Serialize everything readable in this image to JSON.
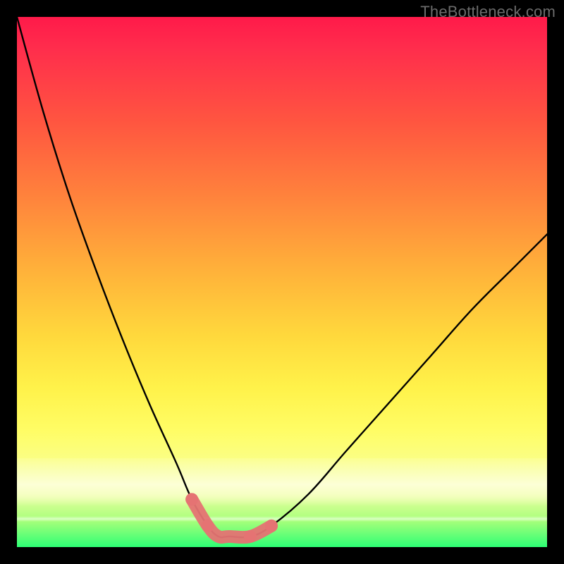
{
  "watermark": "TheBottleneck.com",
  "chart_data": {
    "type": "line",
    "title": "",
    "xlabel": "",
    "ylabel": "",
    "xlim": [
      0,
      100
    ],
    "ylim": [
      0,
      100
    ],
    "series": [
      {
        "name": "bottleneck-curve",
        "x": [
          0,
          5,
          10,
          15,
          20,
          25,
          30,
          33,
          36,
          38,
          40,
          44,
          48,
          55,
          62,
          70,
          78,
          86,
          94,
          100
        ],
        "values": [
          100,
          82,
          66,
          52,
          39,
          27,
          16,
          9,
          4,
          2,
          2,
          2,
          4,
          10,
          18,
          27,
          36,
          45,
          53,
          59
        ]
      }
    ],
    "marker_segment": {
      "name": "optimal-range",
      "x": [
        33,
        36,
        38,
        40,
        44,
        48
      ],
      "values": [
        9,
        4,
        2,
        2,
        2,
        4
      ],
      "color": "#e57373"
    },
    "background": {
      "type": "vertical-gradient",
      "stops": [
        {
          "pos": 0.0,
          "color": "#ff1a4a"
        },
        {
          "pos": 0.34,
          "color": "#ff833c"
        },
        {
          "pos": 0.6,
          "color": "#ffd83c"
        },
        {
          "pos": 0.84,
          "color": "#faff87"
        },
        {
          "pos": 1.0,
          "color": "#2dff75"
        }
      ]
    }
  }
}
